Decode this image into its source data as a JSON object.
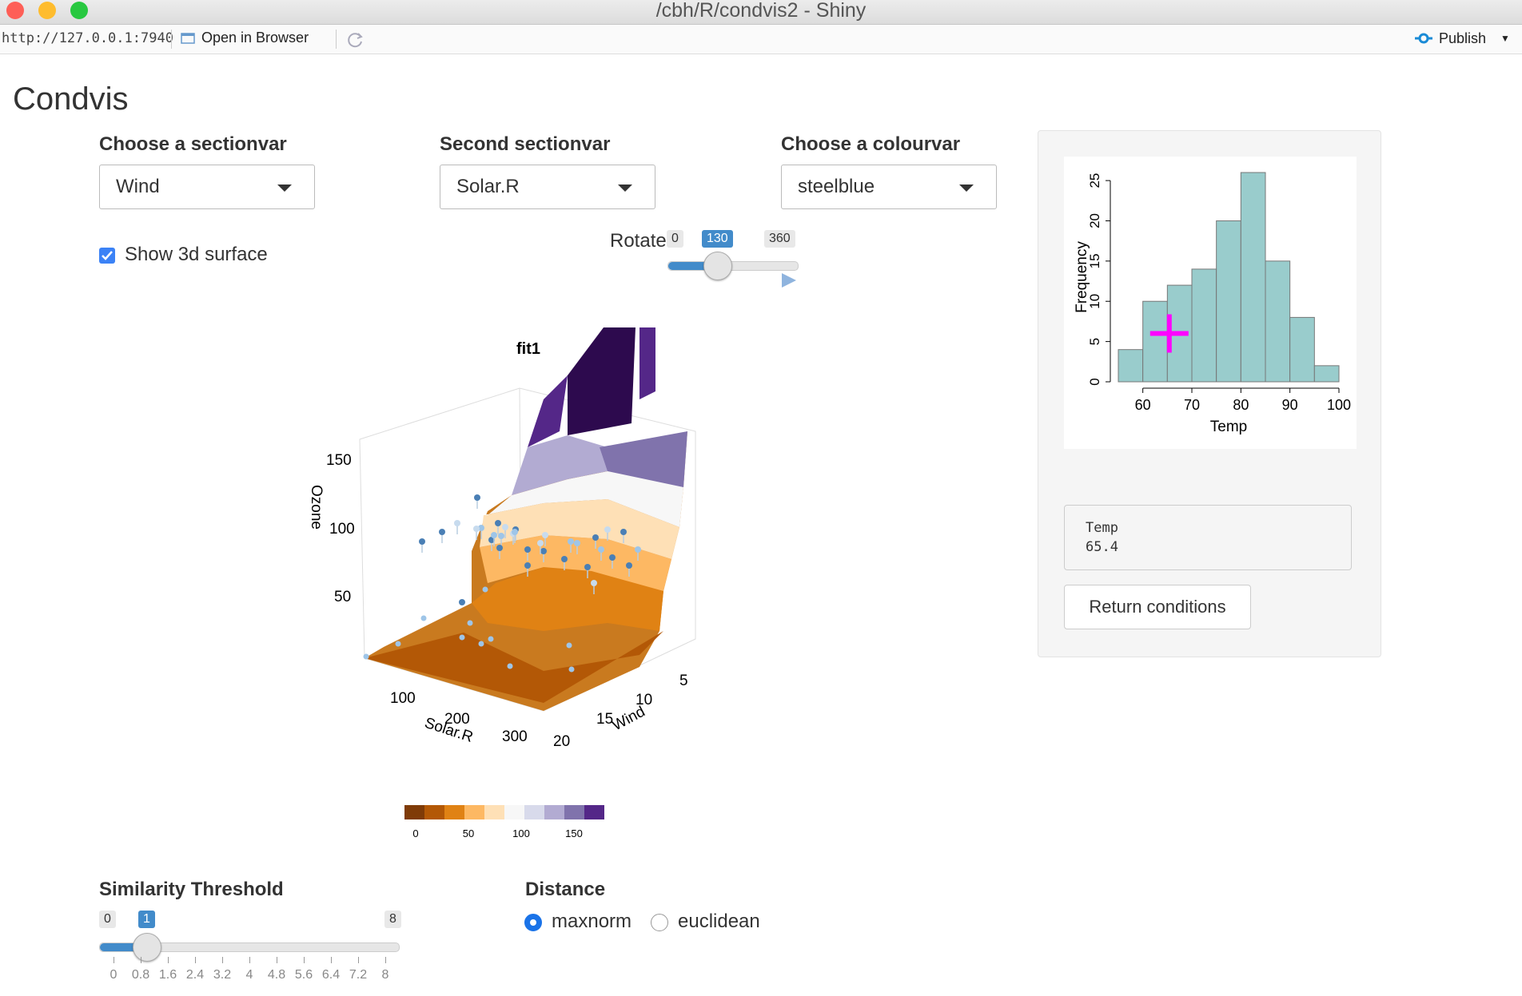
{
  "window": {
    "title": "/cbh/R/condvis2 - Shiny"
  },
  "urlbar": {
    "url": "http://127.0.0.1:7940",
    "open_in_browser": "Open in Browser",
    "publish": "Publish"
  },
  "app": {
    "title": "Condvis"
  },
  "controls": {
    "sectionvar": {
      "label": "Choose a sectionvar",
      "value": "Wind"
    },
    "sectionvar2": {
      "label": "Second sectionvar",
      "value": "Solar.R"
    },
    "colourvar": {
      "label": "Choose a colourvar",
      "value": "steelblue"
    },
    "show3d": {
      "label": "Show 3d surface",
      "checked": true
    },
    "rotate": {
      "label": "Rotate",
      "min": "0",
      "max": "360",
      "value": "130"
    }
  },
  "plot3d": {
    "title": "fit1",
    "zlabel": "Ozone",
    "xlabel": "Solar.R",
    "ylabel": "Wind",
    "z_ticks": [
      "150",
      "100",
      "50"
    ],
    "x_ticks": [
      "100",
      "200",
      "300"
    ],
    "y_ticks": [
      "5",
      "10",
      "15",
      "20"
    ],
    "colorbar": {
      "colors": [
        "#7f3b08",
        "#b35806",
        "#e08214",
        "#fdb863",
        "#fee0b6",
        "#f7f7f7",
        "#d8daeb",
        "#b2abd2",
        "#8073ac",
        "#542788"
      ],
      "ticks": [
        "0",
        "50",
        "100",
        "150"
      ]
    }
  },
  "histogram": {
    "ylabel": "Frequency",
    "xlabel": "Temp",
    "x_ticks": [
      "60",
      "70",
      "80",
      "90",
      "100"
    ],
    "y_ticks": [
      "0",
      "5",
      "10",
      "15",
      "20",
      "25"
    ],
    "marker_color": "#ff00ff",
    "bar_color": "#99cccc",
    "chart_data": {
      "type": "bar",
      "bin_edges": [
        55,
        60,
        65,
        70,
        75,
        80,
        85,
        90,
        95,
        100
      ],
      "values": [
        4,
        10,
        12,
        14,
        20,
        26,
        15,
        8,
        2
      ],
      "xlim": [
        55,
        100
      ],
      "ylim": [
        0,
        26
      ],
      "marker": {
        "x": 65.4,
        "y": 6
      }
    }
  },
  "temp_output": {
    "name": "Temp",
    "value": "65.4"
  },
  "return_button": "Return conditions",
  "similarity": {
    "label": "Similarity Threshold",
    "min": "0",
    "max": "8",
    "value": "1",
    "ticks": [
      "0",
      "0.8",
      "1.6",
      "2.4",
      "3.2",
      "4",
      "4.8",
      "5.6",
      "6.4",
      "7.2",
      "8"
    ]
  },
  "distance": {
    "label": "Distance",
    "options": [
      "maxnorm",
      "euclidean"
    ],
    "selected": "maxnorm"
  }
}
